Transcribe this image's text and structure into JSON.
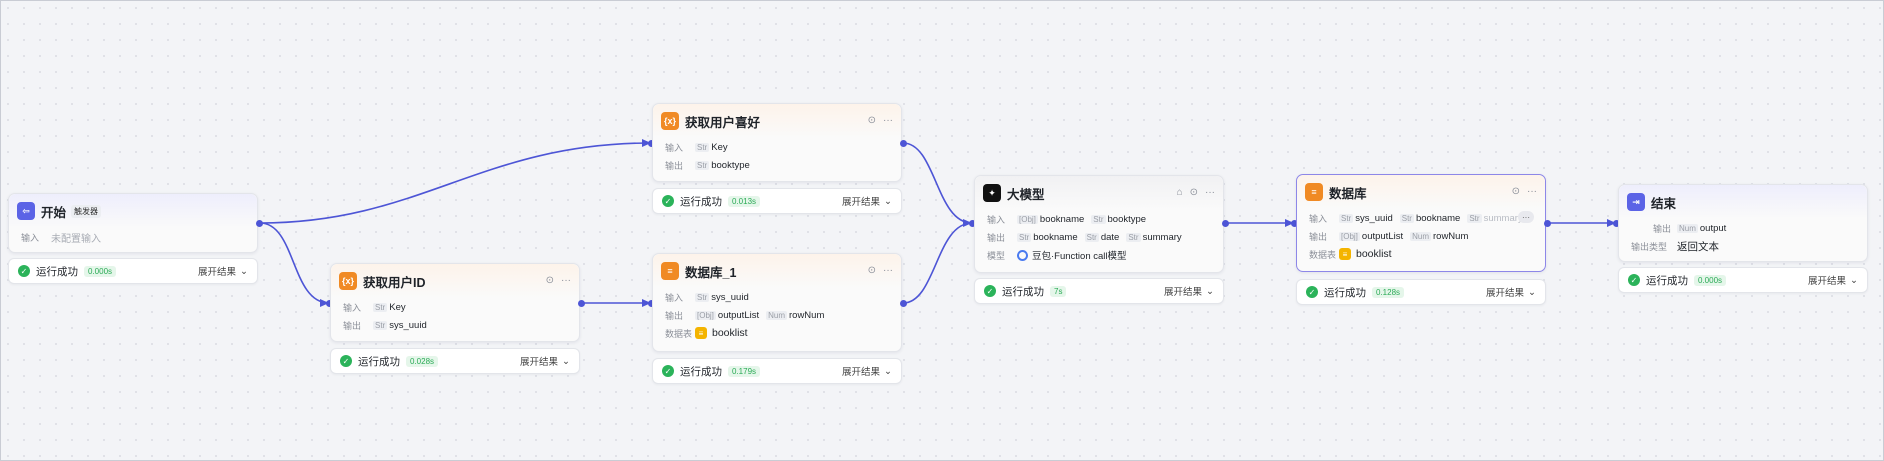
{
  "colors": {
    "edge": "#4d55d6",
    "success": "#2bb35a",
    "accent": "#5b63e6"
  },
  "status_common": {
    "text": "运行成功",
    "expand": "展开结果"
  },
  "start": {
    "title": "开始",
    "badge": "触发器",
    "input_label": "输入",
    "input_placeholder": "未配置输入",
    "time": "0.000s"
  },
  "getuid": {
    "title": "获取用户ID",
    "input_label": "输入",
    "output_label": "输出",
    "input_type": "Str",
    "input_var": "Key",
    "output_type": "Str",
    "output_var": "sys_uuid",
    "time": "0.028s"
  },
  "getpref": {
    "title": "获取用户喜好",
    "input_label": "输入",
    "output_label": "输出",
    "input_type": "Str",
    "input_var": "Key",
    "output_type": "Str",
    "output_var": "booktype",
    "time": "0.013s"
  },
  "db1": {
    "title": "数据库_1",
    "input_label": "输入",
    "output_label": "输出",
    "table_label": "数据表",
    "input_type": "Str",
    "input_var": "sys_uuid",
    "out1_type": "[Obj]",
    "out1_var": "outputList",
    "out2_type": "Num",
    "out2_var": "rowNum",
    "table": "booklist",
    "time": "0.179s"
  },
  "llm": {
    "title": "大模型",
    "input_label": "输入",
    "output_label": "输出",
    "model_label": "模型",
    "in1_type": "[Obj]",
    "in1_var": "bookname",
    "in2_type": "Str",
    "in2_var": "booktype",
    "out1_type": "Str",
    "out1_var": "bookname",
    "out2_type": "Str",
    "out2_var": "date",
    "out3_type": "Str",
    "out3_var": "summary",
    "model": "豆包·Function call模型",
    "time": "7s"
  },
  "db": {
    "title": "数据库",
    "input_label": "输入",
    "output_label": "输出",
    "table_label": "数据表",
    "in1_type": "Str",
    "in1_var": "sys_uuid",
    "in2_type": "Str",
    "in2_var": "bookname",
    "in3_type": "Str",
    "in3_var": "summary",
    "out1_type": "[Obj]",
    "out1_var": "outputList",
    "out2_type": "Num",
    "out2_var": "rowNum",
    "table": "booklist",
    "time": "0.128s"
  },
  "end": {
    "title": "结束",
    "output_label": "输出",
    "output_type_label": "输出类型",
    "out_type": "Num",
    "out_var": "output",
    "output_type_value": "返回文本",
    "time": "0.000s"
  }
}
